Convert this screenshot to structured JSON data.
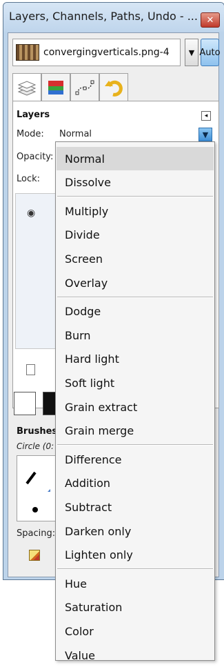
{
  "window": {
    "title": "Layers, Channels, Paths, Undo - ...",
    "close_glyph": "✕"
  },
  "image_selector": {
    "value": "convergingverticals.png-4",
    "dropdown_glyph": "▼",
    "auto_label": "Auto"
  },
  "tabs": [
    {
      "name": "layers",
      "icon": "layers-tab-icon",
      "active": true
    },
    {
      "name": "channels",
      "icon": "channels-tab-icon",
      "active": false
    },
    {
      "name": "paths",
      "icon": "paths-tab-icon",
      "active": false
    },
    {
      "name": "undo",
      "icon": "undo-tab-icon",
      "active": false
    }
  ],
  "layers_panel": {
    "title": "Layers",
    "mode_label": "Mode:",
    "mode_value": "Normal",
    "opacity_label": "Opacity:",
    "lock_label": "Lock:",
    "eye_glyph": "◉"
  },
  "brushes_panel": {
    "title": "Brushes",
    "brush_name": "Circle (0:",
    "spacing_label": "Spacing:"
  },
  "mode_menu": {
    "groups": [
      [
        "Normal",
        "Dissolve"
      ],
      [
        "Multiply",
        "Divide",
        "Screen",
        "Overlay"
      ],
      [
        "Dodge",
        "Burn",
        "Hard light",
        "Soft light",
        "Grain extract",
        "Grain merge"
      ],
      [
        "Difference",
        "Addition",
        "Subtract",
        "Darken only",
        "Lighten only"
      ],
      [
        "Hue",
        "Saturation",
        "Color",
        "Value"
      ]
    ],
    "highlighted": "Normal"
  },
  "colors": {
    "title_bar": "#c9dcf0",
    "close_button": "#c94a3a",
    "auto_button": "#9fcbf0",
    "menu_bg": "#f5f5f5",
    "menu_highlight": "#d9d9d9"
  }
}
